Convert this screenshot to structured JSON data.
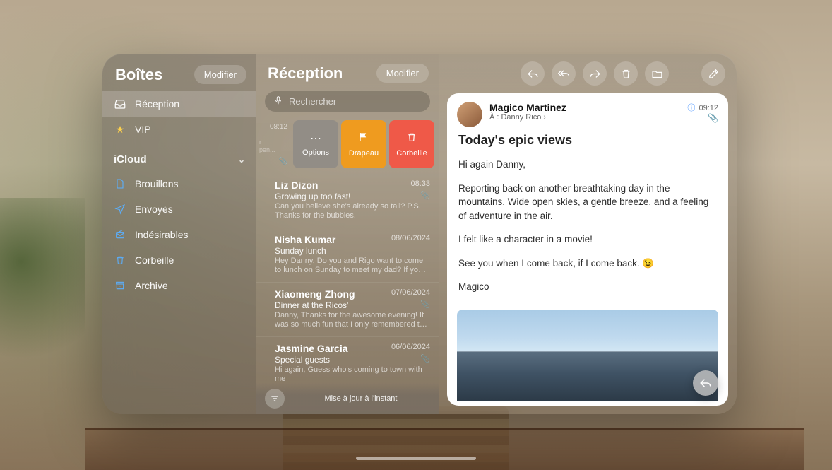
{
  "sidebar": {
    "title": "Boîtes",
    "edit": "Modifier",
    "inbox": {
      "label": "Réception"
    },
    "vip": {
      "label": "VIP"
    },
    "section_icloud": "iCloud",
    "drafts": {
      "label": "Brouillons"
    },
    "sent": {
      "label": "Envoyés"
    },
    "junk": {
      "label": "Indésirables"
    },
    "trash": {
      "label": "Corbeille"
    },
    "archive": {
      "label": "Archive"
    }
  },
  "list": {
    "title": "Réception",
    "edit": "Modifier",
    "search_placeholder": "Rechercher",
    "swipe": {
      "time": "08:12",
      "peek_line1": "r",
      "peek_line2": "pen...",
      "options": "Options",
      "flag": "Drapeau",
      "trash": "Corbeille"
    },
    "status": "Mise à jour à l'instant",
    "messages": [
      {
        "sender": "Liz Dizon",
        "time": "08:33",
        "subject": "Growing up too fast!",
        "preview": "Can you believe she's already so tall? P.S. Thanks for the bubbles.",
        "attach": true
      },
      {
        "sender": "Nisha Kumar",
        "time": "08/06/2024",
        "subject": "Sunday lunch",
        "preview": "Hey Danny, Do you and Rigo want to come to lunch on Sunday to meet my dad? If you two j…",
        "attach": false
      },
      {
        "sender": "Xiaomeng Zhong",
        "time": "07/06/2024",
        "subject": "Dinner at the Ricos'",
        "preview": "Danny, Thanks for the awesome evening! It was so much fun that I only remembered to take o…",
        "attach": true
      },
      {
        "sender": "Jasmine Garcia",
        "time": "06/06/2024",
        "subject": "Special guests",
        "preview": "Hi again, Guess who's coming to town with me",
        "attach": true
      }
    ]
  },
  "reader": {
    "from": "Magico Martinez",
    "to_label": "À :",
    "to_name": "Danny Rico",
    "time": "09:12",
    "subject": "Today's epic views",
    "p1": "Hi again Danny,",
    "p2": "Reporting back on another breathtaking day in the mountains. Wide open skies, a gentle breeze, and a feeling of adventure in the air.",
    "p3": "I felt like a character in a movie!",
    "p4": "See you when I come back, if I come back. 😉",
    "signoff": "Magico"
  }
}
